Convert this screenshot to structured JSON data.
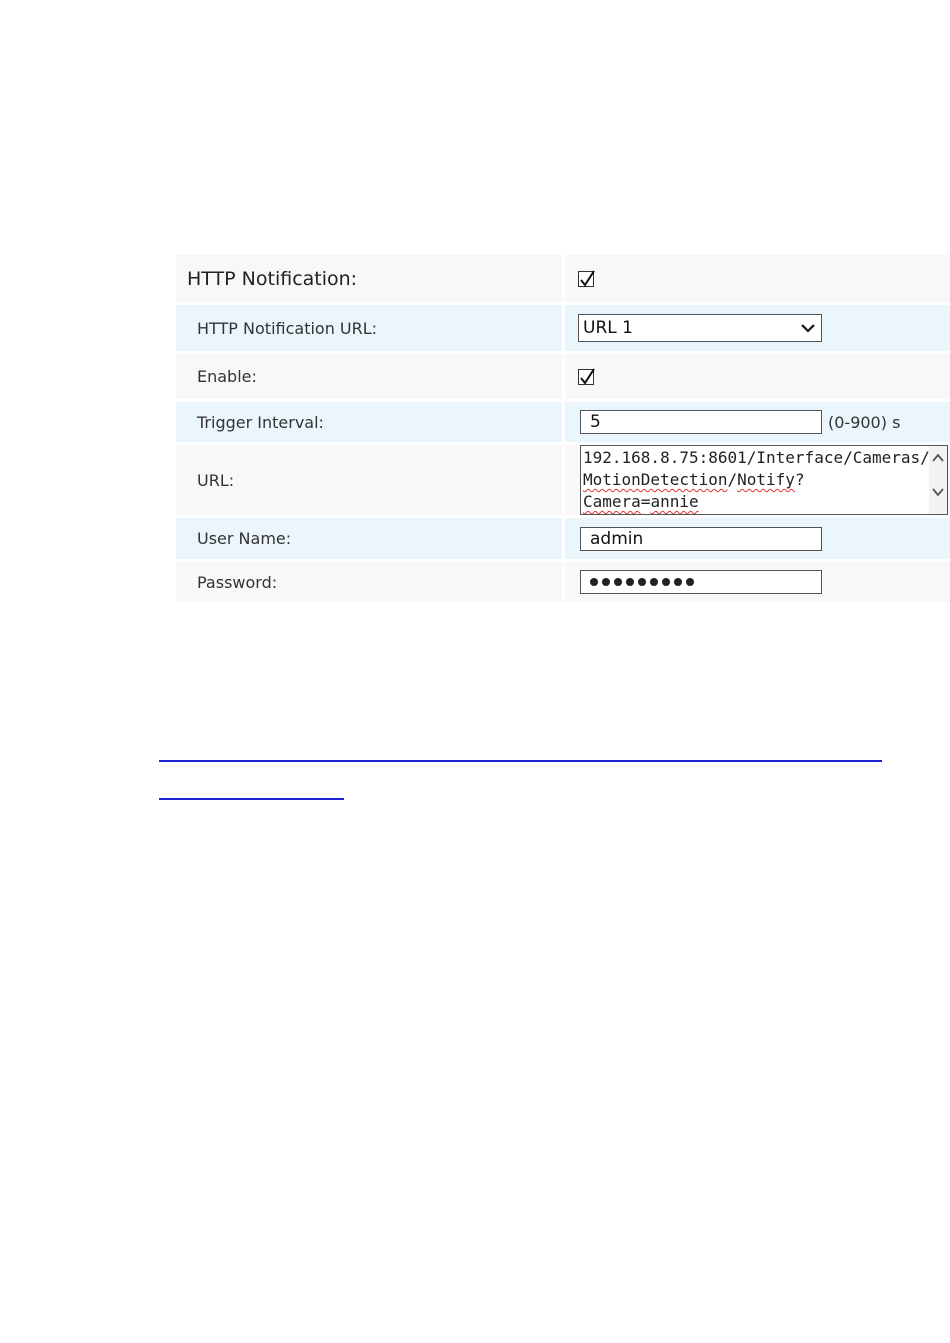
{
  "settings": {
    "http_notification": {
      "label": "HTTP Notification:",
      "checked": true
    },
    "http_notification_url": {
      "label": "HTTP Notification URL:",
      "selected": "URL 1"
    },
    "enable": {
      "label": "Enable:",
      "checked": true
    },
    "trigger_interval": {
      "label": "Trigger Interval:",
      "value": "5",
      "range": "(0-900) s"
    },
    "url": {
      "label": "URL:",
      "text_part1": "192.168.8.75:8601/Interface/Cameras/",
      "text_part2": "MotionDetection",
      "text_part3": "/",
      "text_part4": "Notify",
      "text_part5": "?",
      "text_part6": "Camera",
      "text_part7": "=",
      "text_part8": "annie"
    },
    "user_name": {
      "label": "User Name:",
      "value": "admin"
    },
    "password": {
      "label": "Password:",
      "masked_length": 9
    }
  },
  "icons": {
    "checkmark": "check-icon",
    "dropdown": "chevron-down-icon",
    "scroll_up": "chevron-up-icon",
    "scroll_down": "chevron-down-icon"
  },
  "colors": {
    "row_white": "#f8f8f8",
    "row_blue": "#eaf6fc",
    "link": "#1f1fd6"
  }
}
